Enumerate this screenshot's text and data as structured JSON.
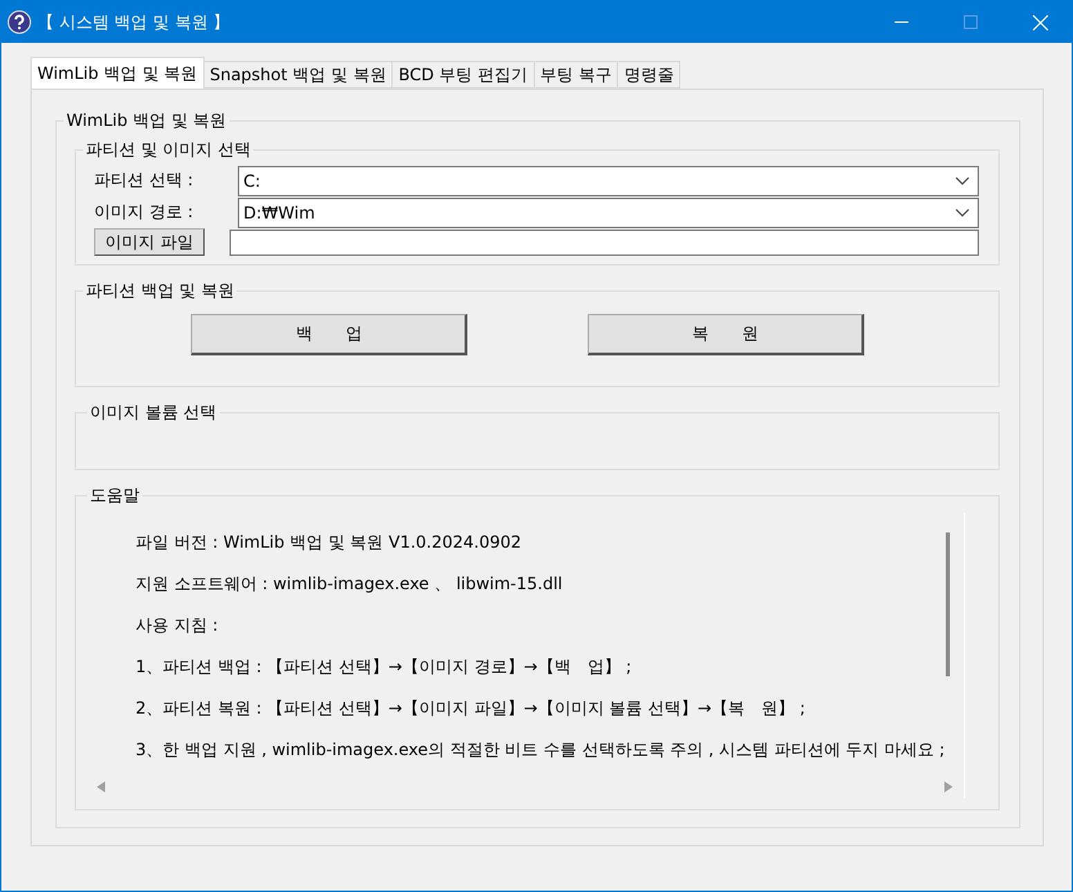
{
  "window": {
    "title": "【 시스템 백업 및 복원 】"
  },
  "tabs": [
    {
      "label": "WimLib 백업 및 복원",
      "selected": true
    },
    {
      "label": "Snapshot 백업 및 복원",
      "selected": false
    },
    {
      "label": "BCD 부팅 편집기",
      "selected": false
    },
    {
      "label": "부팅 복구",
      "selected": false
    },
    {
      "label": "명령줄",
      "selected": false
    }
  ],
  "main_group": {
    "title": "WimLib 백업 및 복원"
  },
  "selection_group": {
    "title": "파티션 및 이미지 선택",
    "partition": {
      "label": "파티션 선택 :",
      "value": "C:"
    },
    "image_path": {
      "label": "이미지 경로 :",
      "value": "D:₩Wim"
    },
    "image_file": {
      "button": "이미지 파일"
    }
  },
  "backup_group": {
    "title": "파티션 백업 및 복원",
    "buttons": [
      "백　　업",
      "복　　원"
    ]
  },
  "volume_group": {
    "title": "이미지 볼륨 선택"
  },
  "help_group": {
    "title": "도움말",
    "lines": [
      "파일 버전 : WimLib 백업 및 복원 V1.0.2024.0902",
      "지원 소프트웨어 : wimlib-imagex.exe 、 libwim-15.dll",
      "사용 지침 :",
      "1、파티션 백업 : 【파티션 선택】→【이미지 경로】→【백　업】 ;",
      "2、파티션 복원 : 【파티션 선택】→【이미지 파일】→【이미지 볼륨 선택】→【복　원】 ;",
      "3、한 백업 지원 , wimlib-imagex.exe의 적절한 비트 수를 선택하도록 주의 , 시스템 파티션에 두지 마세요 ;"
    ]
  }
}
